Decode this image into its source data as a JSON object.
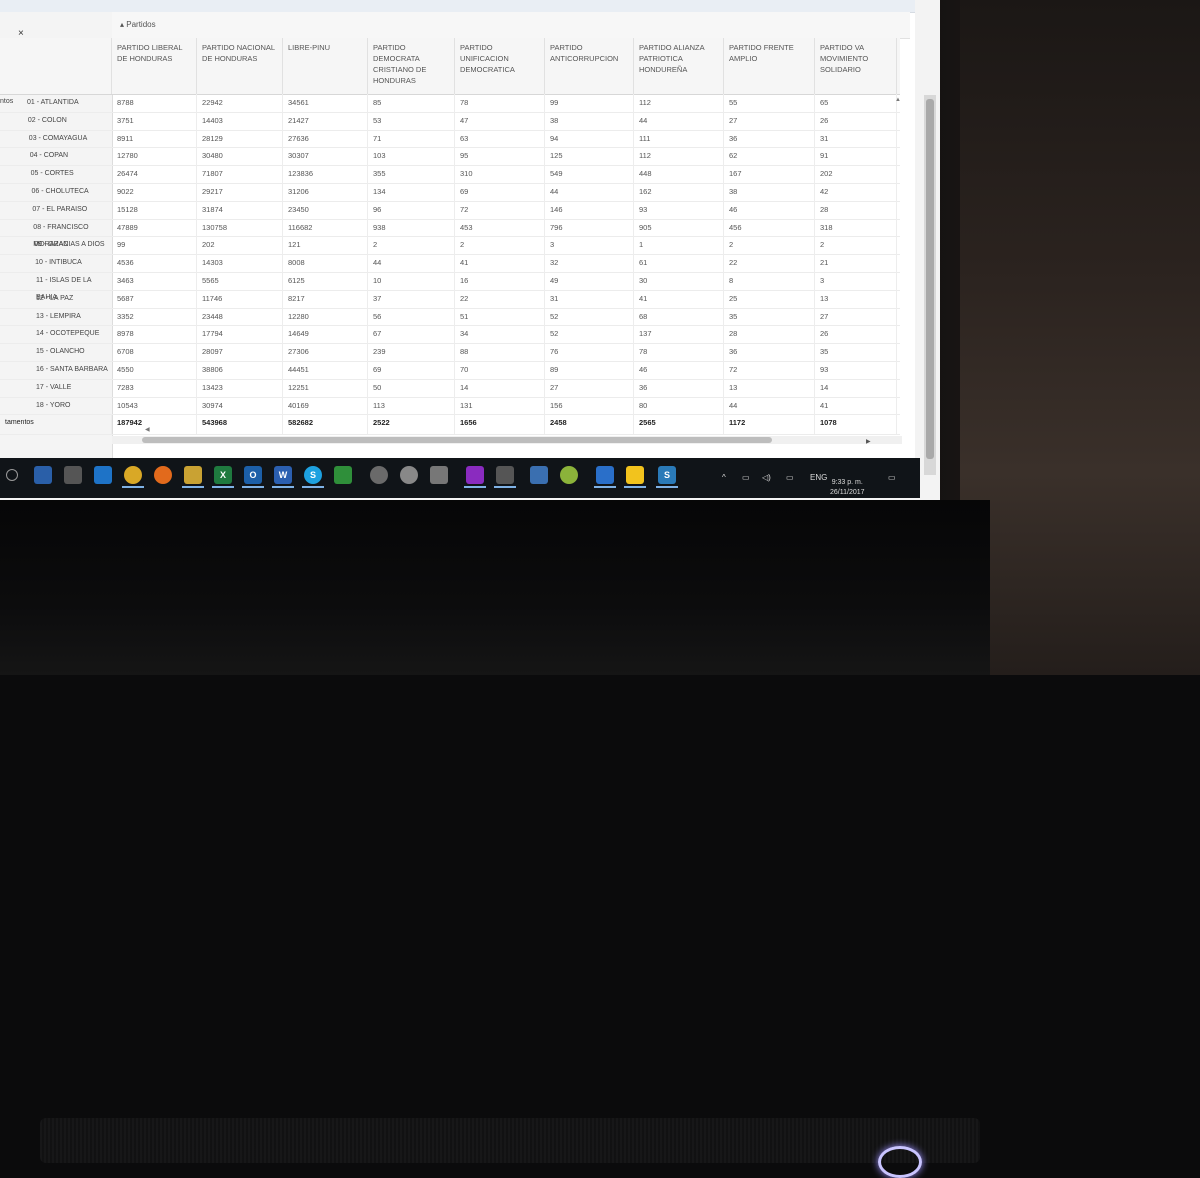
{
  "app": {
    "close_label": "×",
    "group_header": "▴ Partidos"
  },
  "columns": [
    "PARTIDO LIBERAL DE HONDURAS",
    "PARTIDO NACIONAL DE HONDURAS",
    "LIBRE-PINU",
    "PARTIDO DEMOCRATA CRISTIANO DE HONDURAS",
    "PARTIDO UNIFICACION DEMOCRATICA",
    "PARTIDO ANTICORRUPCION",
    "PARTIDO ALIANZA PATRIOTICA HONDUREÑA",
    "PARTIDO FRENTE AMPLIO",
    "PARTIDO VA MOVIMIENTO SOLIDARIO"
  ],
  "row_group_label": "ntos",
  "total_label": "tamentos",
  "rows": [
    {
      "label": "01 - ATLANTIDA",
      "values": [
        "8788",
        "22942",
        "34561",
        "85",
        "78",
        "99",
        "112",
        "55",
        "65"
      ]
    },
    {
      "label": "02 - COLON",
      "values": [
        "3751",
        "14403",
        "21427",
        "53",
        "47",
        "38",
        "44",
        "27",
        "26"
      ]
    },
    {
      "label": "03 - COMAYAGUA",
      "values": [
        "8911",
        "28129",
        "27636",
        "71",
        "63",
        "94",
        "111",
        "36",
        "31"
      ]
    },
    {
      "label": "04 - COPAN",
      "values": [
        "12780",
        "30480",
        "30307",
        "103",
        "95",
        "125",
        "112",
        "62",
        "91"
      ]
    },
    {
      "label": "05 - CORTES",
      "values": [
        "26474",
        "71807",
        "123836",
        "355",
        "310",
        "549",
        "448",
        "167",
        "202"
      ]
    },
    {
      "label": "06 - CHOLUTECA",
      "values": [
        "9022",
        "29217",
        "31206",
        "134",
        "69",
        "44",
        "162",
        "38",
        "42"
      ]
    },
    {
      "label": "07 - EL PARAISO",
      "values": [
        "15128",
        "31874",
        "23450",
        "96",
        "72",
        "146",
        "93",
        "46",
        "28"
      ]
    },
    {
      "label": "08 - FRANCISCO MORAZAN",
      "values": [
        "47889",
        "130758",
        "116682",
        "938",
        "453",
        "796",
        "905",
        "456",
        "318"
      ]
    },
    {
      "label": "09 - GRACIAS A DIOS",
      "values": [
        "99",
        "202",
        "121",
        "2",
        "2",
        "3",
        "1",
        "2",
        "2"
      ]
    },
    {
      "label": "10 - INTIBUCA",
      "values": [
        "4536",
        "14303",
        "8008",
        "44",
        "41",
        "32",
        "61",
        "22",
        "21"
      ]
    },
    {
      "label": "11 - ISLAS DE LA BAHIA",
      "values": [
        "3463",
        "5565",
        "6125",
        "10",
        "16",
        "49",
        "30",
        "8",
        "3"
      ]
    },
    {
      "label": "12 - LA PAZ",
      "values": [
        "5687",
        "11746",
        "8217",
        "37",
        "22",
        "31",
        "41",
        "25",
        "13"
      ]
    },
    {
      "label": "13 - LEMPIRA",
      "values": [
        "3352",
        "23448",
        "12280",
        "56",
        "51",
        "52",
        "68",
        "35",
        "27"
      ]
    },
    {
      "label": "14 - OCOTEPEQUE",
      "values": [
        "8978",
        "17794",
        "14649",
        "67",
        "34",
        "52",
        "137",
        "28",
        "26"
      ]
    },
    {
      "label": "15 - OLANCHO",
      "values": [
        "6708",
        "28097",
        "27306",
        "239",
        "88",
        "76",
        "78",
        "36",
        "35"
      ]
    },
    {
      "label": "16 - SANTA BARBARA",
      "values": [
        "4550",
        "38806",
        "44451",
        "69",
        "70",
        "89",
        "46",
        "72",
        "93"
      ]
    },
    {
      "label": "17 - VALLE",
      "values": [
        "7283",
        "13423",
        "12251",
        "50",
        "14",
        "27",
        "36",
        "13",
        "14"
      ]
    },
    {
      "label": "18 - YORO",
      "values": [
        "10543",
        "30974",
        "40169",
        "113",
        "131",
        "156",
        "80",
        "44",
        "41"
      ]
    }
  ],
  "totals": [
    "187942",
    "543968",
    "582682",
    "2522",
    "1656",
    "2458",
    "2565",
    "1172",
    "1078"
  ],
  "taskbar": {
    "tray_lang": "ENG",
    "clock_time": "9:33 p. m.",
    "clock_date": "26/11/2017"
  },
  "colors": {
    "taskbar_bg": "#101418",
    "accent": "#7fb2e6"
  }
}
